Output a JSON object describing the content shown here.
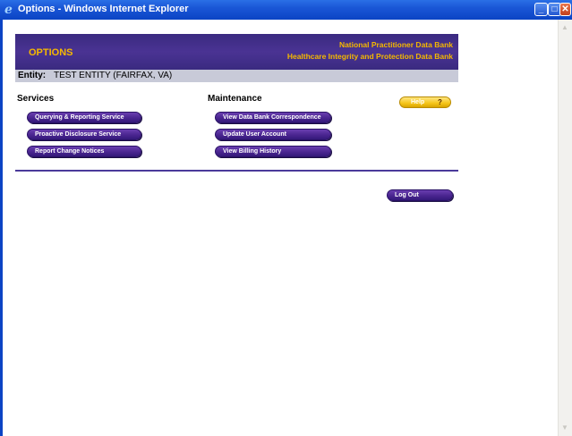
{
  "window": {
    "title": "Options - Windows Internet Explorer",
    "buttons": {
      "minimize": "_",
      "maximize": "□",
      "close": "✕"
    }
  },
  "header": {
    "title": "OPTIONS",
    "org_line1": "National Practitioner Data Bank",
    "org_line2": "Healthcare Integrity and Protection Data Bank"
  },
  "entity": {
    "label": "Entity:",
    "value": "TEST ENTITY  (FAIRFAX, VA)"
  },
  "services": {
    "heading": "Services",
    "buttons": [
      "Querying & Reporting Service",
      "Proactive Disclosure Service",
      "Report Change Notices"
    ]
  },
  "maintenance": {
    "heading": "Maintenance",
    "buttons": [
      "View Data Bank Correspondence",
      "Update User Account",
      "View Billing History"
    ]
  },
  "help": {
    "label": "Help",
    "icon": "?"
  },
  "logout": {
    "label": "Log Out"
  }
}
